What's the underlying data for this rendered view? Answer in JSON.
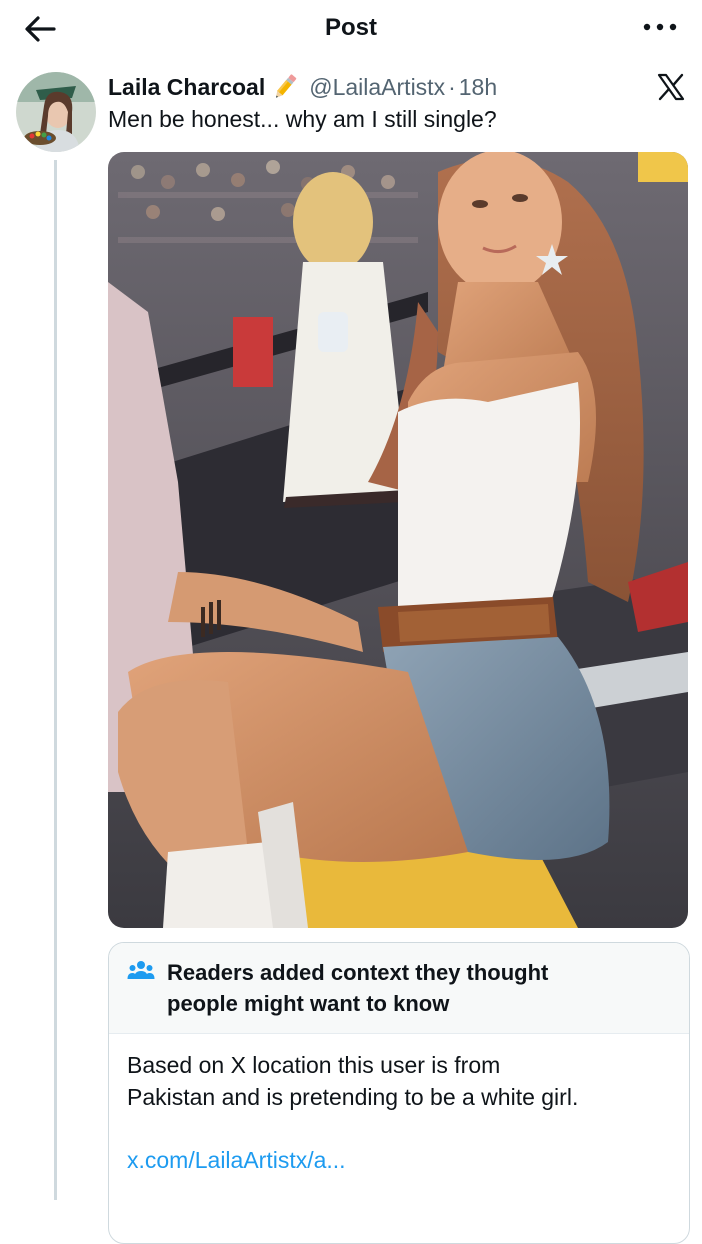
{
  "header": {
    "title": "Post",
    "back_icon": "arrow-left-icon",
    "more_icon": "ellipsis-icon"
  },
  "tweet": {
    "author_name": "Laila Charcoal",
    "badge_icon": "pencil-emoji-icon",
    "handle": "@LailaArtistx",
    "separator": "·",
    "time": "18h",
    "text": "Men be honest... why am I still single?",
    "platform_icon": "x-logo-icon",
    "media_icon": "photo"
  },
  "community_note": {
    "icon": "people-icon",
    "title_line1": "Readers added context they thought",
    "title_line2": "people might want to know",
    "body_line1": "Based on X location this user is from",
    "body_line2": "Pakistan and is pretending to be a white girl.",
    "link": "x.com/LailaArtistx/a..."
  },
  "colors": {
    "text": "#0f1419",
    "secondary": "#536471",
    "link": "#1d9bf0",
    "border": "#cfd9de",
    "note_bg": "#f7f9f9"
  }
}
